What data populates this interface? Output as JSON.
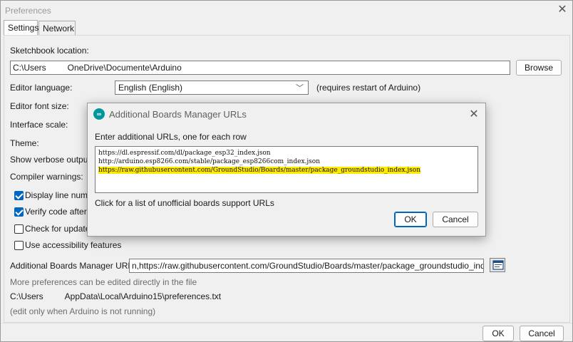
{
  "preferences": {
    "title": "Preferences",
    "tabs": [
      "Settings",
      "Network"
    ],
    "sketchbook_label": "Sketchbook location:",
    "sketchbook_path_prefix": "C:\\Users",
    "sketchbook_path_suffix": "OneDrive\\Documente\\Arduino",
    "browse_label": "Browse",
    "editor_language_label": "Editor language:",
    "editor_language_value": "English (English)",
    "editor_language_note": "(requires restart of Arduino)",
    "font_size_label": "Editor font size:",
    "interface_scale_label": "Interface scale:",
    "theme_label": "Theme:",
    "verbose_label": "Show verbose output d",
    "compiler_warnings_label": "Compiler warnings:",
    "checkboxes": [
      {
        "label": "Display line numbe",
        "checked": true
      },
      {
        "label": "Verify code after u",
        "checked": true
      },
      {
        "label": "Check for updates",
        "checked": false
      },
      {
        "label": "Use accessibility features",
        "checked": false
      }
    ],
    "boards_urls_label": "Additional Boards Manager URLs:",
    "boards_urls_value": "n,https://raw.githubusercontent.com/GroundStudio/Boards/master/package_groundstudio_index.json",
    "more_prefs_text": "More preferences can be edited directly in the file",
    "prefs_path_prefix": "C:\\Users",
    "prefs_path_suffix": "AppData\\Local\\Arduino15\\preferences.txt",
    "edit_note": "(edit only when Arduino is not running)",
    "ok_label": "OK",
    "cancel_label": "Cancel",
    "close_icon": "close-icon"
  },
  "dialog": {
    "title": "Additional Boards Manager URLs",
    "instruction": "Enter additional URLs, one for each row",
    "urls": [
      "https://dl.espressif.com/dl/package_esp32_index.json",
      "http://arduino.esp8266.com/stable/package_esp8266com_index.json",
      "https://raw.githubusercontent.com/GroundStudio/Boards/master/package_groundstudio_index.json"
    ],
    "link_text": "Click for a list of unofficial boards support URLs",
    "ok_label": "OK",
    "cancel_label": "Cancel"
  },
  "colors": {
    "accent": "#0067c0",
    "highlight": "#ffea00",
    "arduino_logo": "#00979c"
  }
}
